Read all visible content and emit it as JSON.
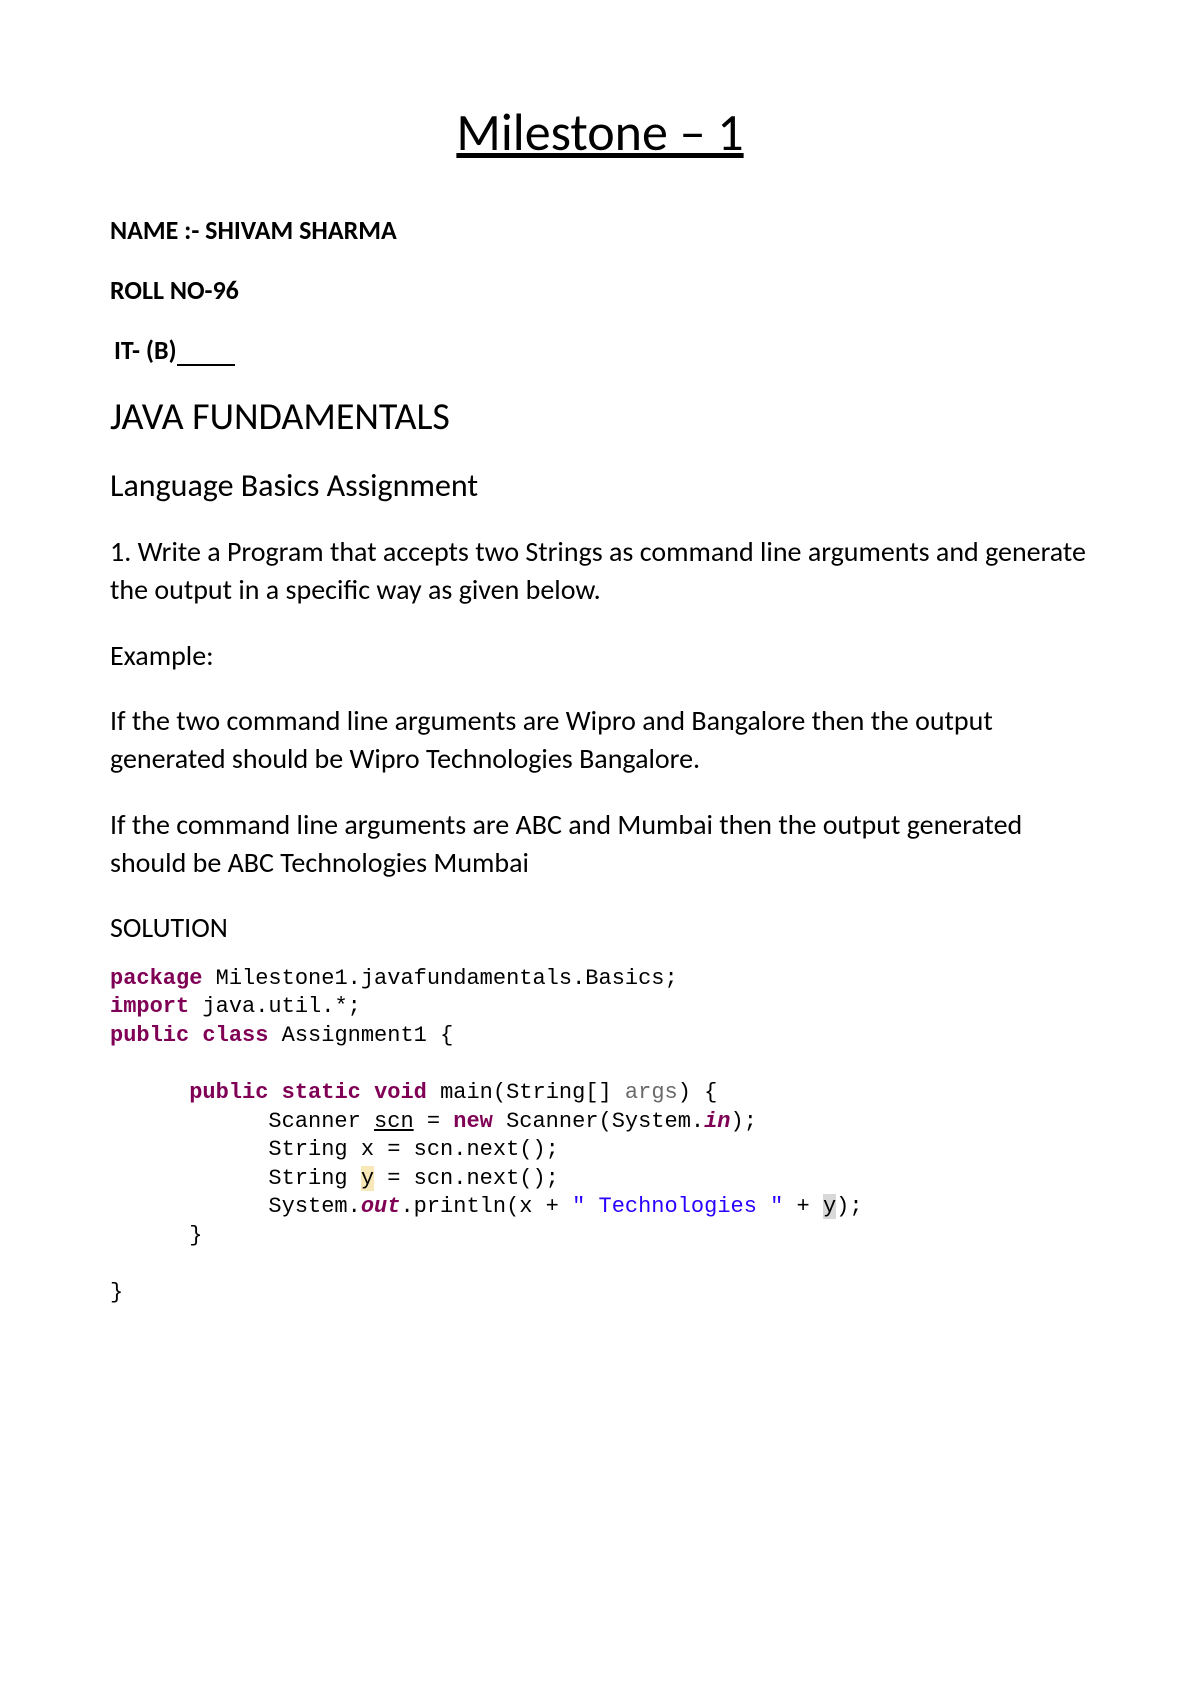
{
  "title": "Milestone – 1",
  "name_line": "NAME :- SHIVAM SHARMA",
  "roll_line": "ROLL NO-96",
  "section_prefix": "IT- (B)",
  "heading1": "JAVA FUNDAMENTALS",
  "heading2": "Language Basics Assignment",
  "question": "1. Write a Program that accepts two Strings as command line arguments and generate the output in a specific way as given below.",
  "example_label": "Example:",
  "example_para1": "If the two command line arguments are Wipro and Bangalore then the output generated should be Wipro Technologies Bangalore.",
  "example_para2": "If the command line arguments are ABC and Mumbai then the output generated should be ABC Technologies Mumbai",
  "solution_label": "SOLUTION",
  "code": {
    "package_kw": "package",
    "package_name": " Milestone1.javafundamentals.Basics;",
    "import_kw": "import",
    "import_name": " java.util.*;",
    "public_kw": "public",
    "class_kw": "class",
    "class_name": " Assignment1 {",
    "static_kw": "static",
    "void_kw": "void",
    "main_sig1": " main(String[] ",
    "args": "args",
    "main_sig2": ") {",
    "scanner_line1": "            Scanner ",
    "scn": "scn",
    "scanner_line2": " = ",
    "new_kw": "new",
    "scanner_line3": " Scanner(System.",
    "in": "in",
    "scanner_line4": ");",
    "x_line1": "            String x = scn.next();",
    "y_line1": "            String ",
    "y_var": "y",
    "y_line2": " = scn.next();",
    "out_line1": "            System.",
    "out": "out",
    "out_line2": ".println(x + ",
    "str_lit": "\" Technologies \"",
    "out_line3": " + ",
    "y_end": "y",
    "out_line4": ");",
    "close1": "      }",
    "close2": "}"
  }
}
